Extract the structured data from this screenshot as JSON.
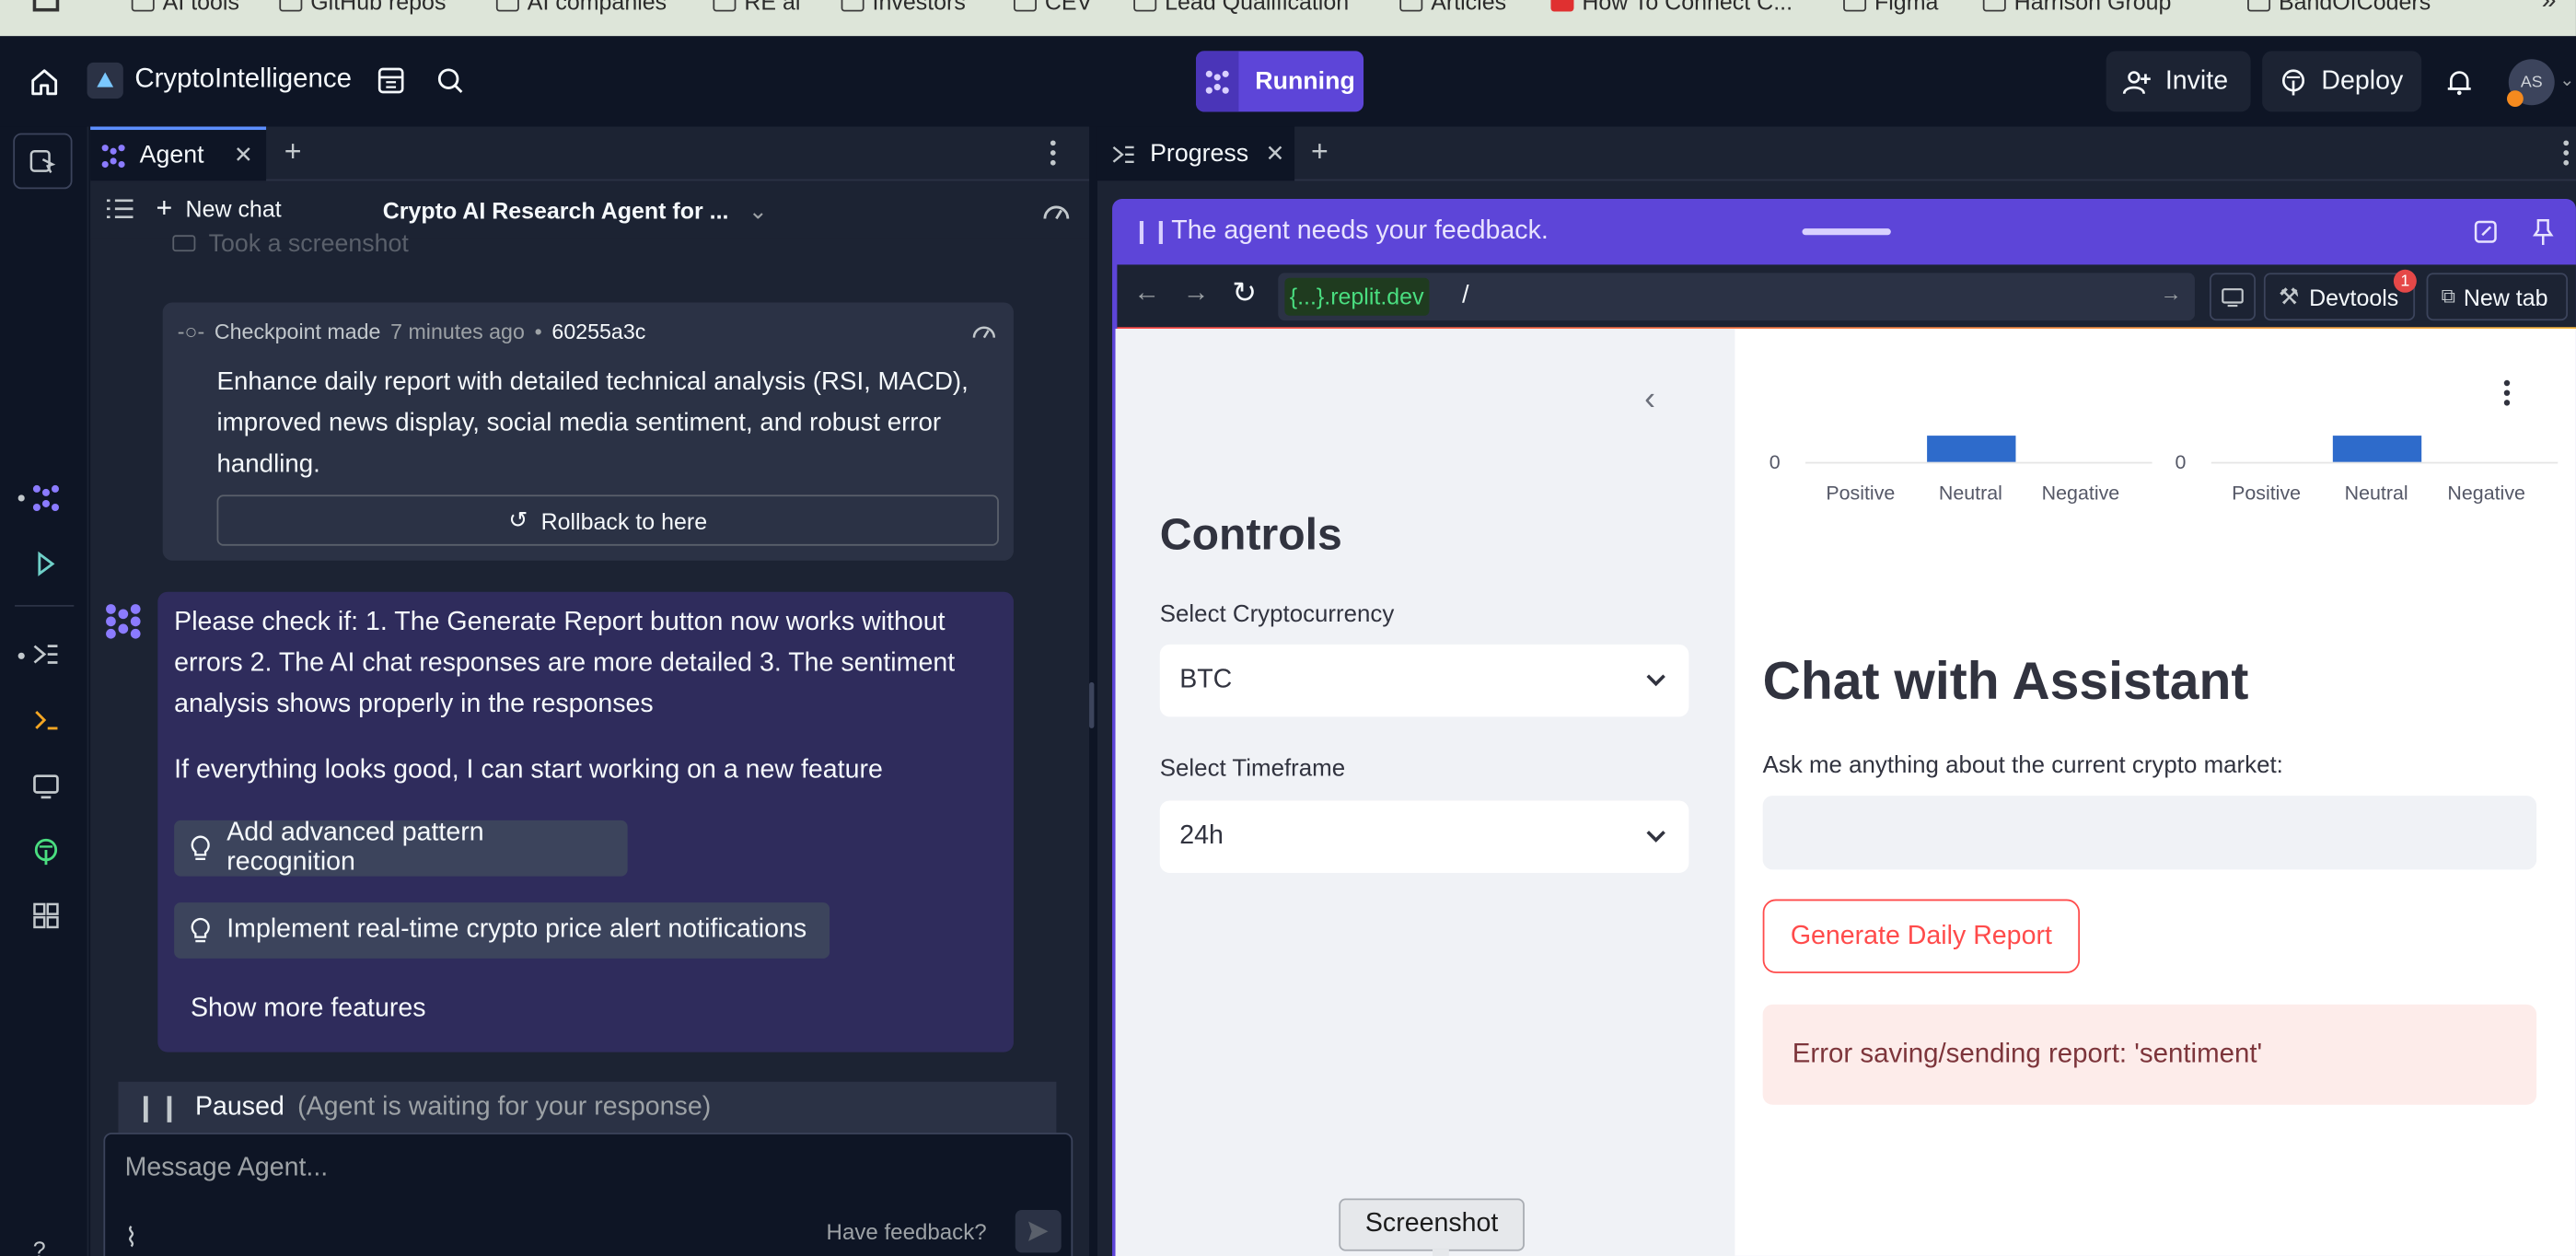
{
  "bookmarks": [
    "AI tools",
    "GitHub repos",
    "AI companies",
    "RE ai",
    "Investors",
    "CEV",
    "Lead Qualification",
    "Articles",
    "How To Connect C...",
    "Figma",
    "Harrison Group",
    "BandOfCoders"
  ],
  "topbar": {
    "project_name": "CryptoIntelligence",
    "run_label": "Running",
    "invite_label": "Invite",
    "deploy_label": "Deploy",
    "avatar_initials": "AS"
  },
  "agent_panel": {
    "tab_label": "Agent",
    "new_chat_label": "New chat",
    "chat_title": "Crypto AI Research Agent for ...",
    "faded_line": "Took a screenshot",
    "checkpoint": {
      "label": "Checkpoint made",
      "time": "7 minutes ago",
      "separator": "•",
      "hash": "60255a3c",
      "description": "Enhance daily report with detailed technical analysis (RSI, MACD), improved news display, social media sentiment, and robust error handling.",
      "rollback_label": "Rollback to here"
    },
    "message": {
      "text": "Please check if: 1. The Generate Report button now works without errors 2. The AI chat responses are more detailed 3. The sentiment analysis shows properly in the responses",
      "followup": "If everything looks good, I can start working on a new feature",
      "suggestions": [
        "Add advanced pattern recognition",
        "Implement real-time crypto price alert notifications"
      ],
      "show_more": "Show more features"
    },
    "status": {
      "label": "Paused",
      "detail": "(Agent is waiting for your response)"
    },
    "input_placeholder": "Message Agent...",
    "feedback_label": "Have feedback?"
  },
  "progress_panel": {
    "tab_label": "Progress",
    "banner_text": "The agent needs your feedback.",
    "url_domain": "{...}.replit.dev",
    "url_path": "/",
    "devtools_label": "Devtools",
    "devtools_badge": "1",
    "new_tab_label": "New tab",
    "screenshot_label": "Screenshot"
  },
  "app": {
    "controls_title": "Controls",
    "crypto_label": "Select Cryptocurrency",
    "crypto_value": "BTC",
    "timeframe_label": "Select Timeframe",
    "timeframe_value": "24h",
    "chat_title": "Chat with Assistant",
    "chat_prompt": "Ask me anything about the current crypto market:",
    "generate_button": "Generate Daily Report",
    "error_text": "Error saving/sending report: 'sentiment'",
    "bar_color": "#2e6bcb",
    "error_bg": "#fdecea",
    "error_color": "#7d353b"
  },
  "chart_data": [
    {
      "type": "bar",
      "categories": [
        "Positive",
        "Neutral",
        "Negative"
      ],
      "values": [
        0,
        1,
        0
      ],
      "yticks": [
        "0"
      ]
    },
    {
      "type": "bar",
      "categories": [
        "Positive",
        "Neutral",
        "Negative"
      ],
      "values": [
        0,
        1,
        0
      ],
      "yticks": [
        "0"
      ]
    }
  ]
}
